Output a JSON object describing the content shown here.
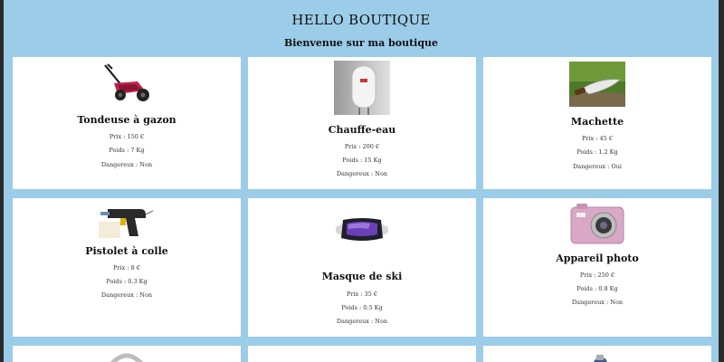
{
  "header": {
    "title": "HELLO BOUTIQUE",
    "subtitle": "Bienvenue sur ma boutique"
  },
  "products": [
    {
      "name": "Tondeuse à gazon",
      "price": "Prix : 150 €",
      "weight": "Poids : 7 Kg",
      "danger": "Dangereux : Non",
      "icon": "lawn-mower"
    },
    {
      "name": "Chauffe-eau",
      "price": "Prix : 200 €",
      "weight": "Poids : 15 Kg",
      "danger": "Dangereux : Non",
      "icon": "water-heater"
    },
    {
      "name": "Machette",
      "price": "Prix : 45 €",
      "weight": "Poids : 1.2 Kg",
      "danger": "Dangereux : Oui",
      "icon": "machete"
    },
    {
      "name": "Pistolet à colle",
      "price": "Prix : 8 €",
      "weight": "Poids : 0.3 Kg",
      "danger": "Dangereux : Non",
      "icon": "glue-gun"
    },
    {
      "name": "Masque de ski",
      "price": "Prix : 35 €",
      "weight": "Poids : 0.5 Kg",
      "danger": "Dangereux : Non",
      "icon": "ski-mask"
    },
    {
      "name": "Appareil photo",
      "price": "Prix : 250 €",
      "weight": "Poids : 0.8 Kg",
      "danger": "Dangereux : Non",
      "icon": "camera"
    }
  ],
  "colors": {
    "page_bg": "#9bcce8",
    "card_bg": "#ffffff",
    "outer_frame": "#2b2b2b"
  }
}
